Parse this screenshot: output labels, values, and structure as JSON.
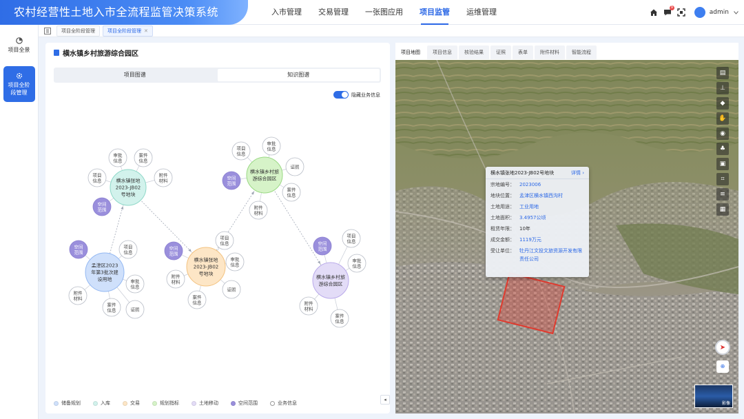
{
  "header": {
    "title": "农村经营性土地入市全流程监管决策系统",
    "nav": [
      {
        "label": "入市管理",
        "active": false
      },
      {
        "label": "交易管理",
        "active": false
      },
      {
        "label": "一张图应用",
        "active": false
      },
      {
        "label": "项目监管",
        "active": true
      },
      {
        "label": "运维管理",
        "active": false
      }
    ],
    "notification_count": "9",
    "user": "admin"
  },
  "sidebar": {
    "items": [
      {
        "label": "项目全景",
        "icon": "pie-chart-icon",
        "active": false
      },
      {
        "label": "项目全阶段管理",
        "icon": "gear-icon",
        "active": true
      }
    ]
  },
  "page_tabs": [
    {
      "label": "项目全阶段管理",
      "active": false
    },
    {
      "label": "项目全阶段管理",
      "active": true,
      "closable": true
    }
  ],
  "left": {
    "title": "横水镇乡村旅游综合园区",
    "segments": [
      {
        "label": "项目图谱",
        "active": false
      },
      {
        "label": "知识图谱",
        "active": true
      }
    ],
    "toggle_label": "隐藏业务信息",
    "graph": {
      "main_nodes": [
        {
          "id": "n1",
          "label": "横水镇张地2023-JB02号地块"
        },
        {
          "id": "n2",
          "label": "横水镇乡村旅游综合园区"
        },
        {
          "id": "n3",
          "label": "孟津区2023年第3批次建设用地"
        },
        {
          "id": "n4",
          "label": "横水镇张地2023-JB02号地块"
        },
        {
          "id": "n5",
          "label": "横水镇乡村旅游综合园区"
        }
      ],
      "sub_nodes": [
        {
          "label": "审批信息"
        },
        {
          "label": "案件信息"
        },
        {
          "label": "项目信息"
        },
        {
          "label": "附件材料"
        },
        {
          "label": "空间范围"
        },
        {
          "label": "项目信息"
        },
        {
          "label": "审批信息"
        },
        {
          "label": "空间范围"
        },
        {
          "label": "证照"
        },
        {
          "label": "案件信息"
        },
        {
          "label": "附件材料"
        },
        {
          "label": "空间范围"
        },
        {
          "label": "项目信息"
        },
        {
          "label": "审批信息"
        },
        {
          "label": "附件材料"
        },
        {
          "label": "案件信息"
        },
        {
          "label": "证照"
        },
        {
          "label": "空间范围"
        },
        {
          "label": "项目信息"
        },
        {
          "label": "审批信息"
        },
        {
          "label": "附件材料"
        },
        {
          "label": "案件信息"
        },
        {
          "label": "证照"
        },
        {
          "label": "空间范围"
        },
        {
          "label": "项目信息"
        },
        {
          "label": "审批信息"
        },
        {
          "label": "附件材料"
        },
        {
          "label": "案件信息"
        }
      ]
    },
    "legend": [
      {
        "label": "储备规划",
        "color": "#cfe0fb",
        "hollow": false
      },
      {
        "label": "入库",
        "color": "#d2f2ec",
        "hollow": false
      },
      {
        "label": "交易",
        "color": "#fde6c6",
        "hollow": false
      },
      {
        "label": "规划指标",
        "color": "#d6f3c8",
        "hollow": false
      },
      {
        "label": "土地移动",
        "color": "#e3dcf7",
        "hollow": false
      },
      {
        "label": "空间范围",
        "color": "#9a8fdc",
        "hollow": false
      },
      {
        "label": "业务信息",
        "color": "#ffffff",
        "hollow": true
      }
    ]
  },
  "right": {
    "tabs": [
      {
        "label": "项目地图",
        "active": true
      },
      {
        "label": "项目信息",
        "active": false
      },
      {
        "label": "核验结果",
        "active": false
      },
      {
        "label": "证照",
        "active": false
      },
      {
        "label": "表单",
        "active": false
      },
      {
        "label": "附件材料",
        "active": false
      },
      {
        "label": "智能流程",
        "active": false
      }
    ],
    "popup": {
      "title": "横水镇张地2023-JB02号地块",
      "detail_link": "详情 ›",
      "rows": [
        {
          "k": "宗地编号：",
          "v": "2023006",
          "plain": false
        },
        {
          "k": "地块位置：",
          "v": "孟津区横水镇西沟村",
          "plain": false
        },
        {
          "k": "土地用途：",
          "v": "工业用地",
          "plain": false
        },
        {
          "k": "土地面积：",
          "v": "3.4957公顷",
          "plain": false
        },
        {
          "k": "租赁年限：",
          "v": "10年",
          "plain": true
        },
        {
          "k": "成交金额：",
          "v": "1119万元",
          "plain": false
        },
        {
          "k": "受让单位：",
          "v": "牡丹江文投文旅资源开发有限责任公司",
          "plain": false
        }
      ]
    },
    "minimap_label": "影像"
  }
}
